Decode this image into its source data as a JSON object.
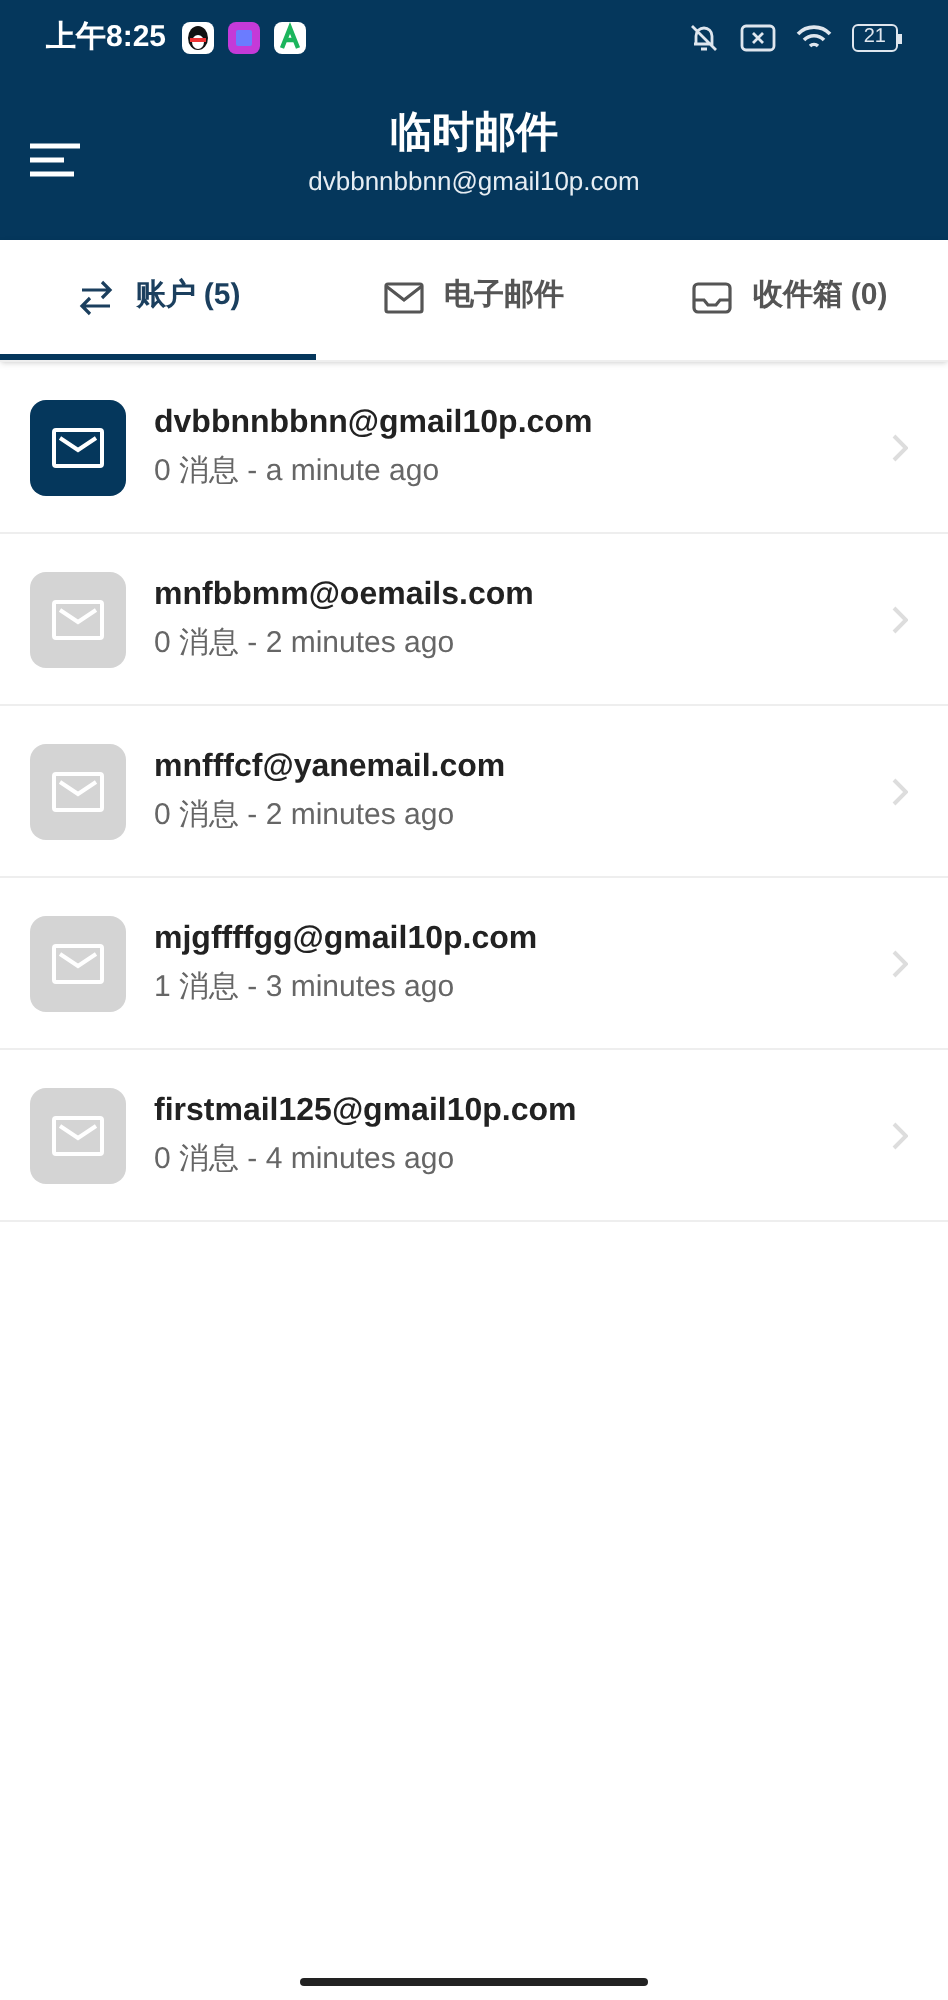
{
  "status_bar": {
    "time": "上午8:25",
    "battery": "21"
  },
  "header": {
    "title": "临时邮件",
    "subtitle": "dvbbnnbbnn@gmail10p.com"
  },
  "tabs": [
    {
      "label": "账户 (5)",
      "kind": "swap",
      "selected": true
    },
    {
      "label": "电子邮件",
      "kind": "mail",
      "selected": false
    },
    {
      "label": "收件箱 (0)",
      "kind": "inbox",
      "selected": false
    }
  ],
  "accounts": [
    {
      "email": "dvbbnnbbnn@gmail10p.com",
      "info": "0 消息 - a minute ago",
      "selected": true
    },
    {
      "email": "mnfbbmm@oemails.com",
      "info": "0 消息 - 2 minutes ago",
      "selected": false
    },
    {
      "email": "mnfffcf@yanemail.com",
      "info": "0 消息 - 2 minutes ago",
      "selected": false
    },
    {
      "email": "mjgffffgg@gmail10p.com",
      "info": "1 消息 - 3 minutes ago",
      "selected": false
    },
    {
      "email": "firstmail125@gmail10p.com",
      "info": "0 消息 - 4 minutes ago",
      "selected": false
    }
  ]
}
